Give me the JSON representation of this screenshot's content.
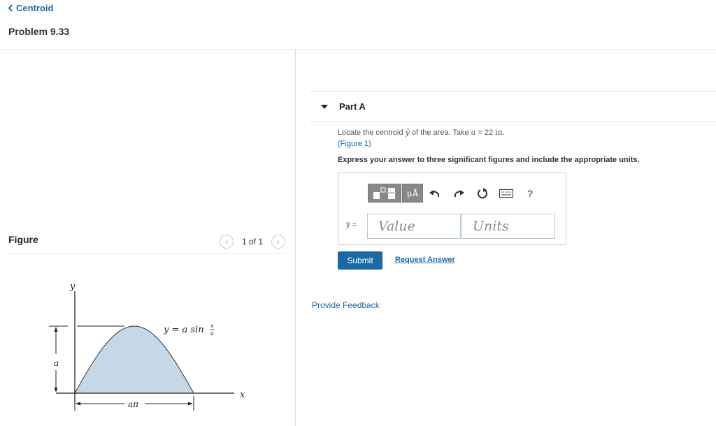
{
  "nav": {
    "back_label": "Centroid"
  },
  "problem": {
    "title": "Problem 9.33"
  },
  "figure_panel": {
    "label": "Figure",
    "pager_text": "1 of 1",
    "figure": {
      "y_axis": "y",
      "x_axis": "x",
      "height_dim": "a",
      "width_dim": "aπ",
      "equation": "y = a sin",
      "eq_num": "x",
      "eq_den": "a"
    }
  },
  "part_a": {
    "title": "Part A",
    "question_prefix": "Locate the centroid",
    "question_symbol": "ȳ",
    "question_middle": "of the area. Take",
    "question_var": "a",
    "question_value": " = 22",
    "question_unit": "in",
    "figure_link": "(Figure 1)",
    "instruction": "Express your answer to three significant figures and include the appropriate units.",
    "toolbar": {
      "units_label": "μÅ",
      "help_label": "?"
    },
    "answer_label": "ȳ =",
    "value_placeholder": "Value",
    "units_placeholder": "Units",
    "submit_label": "Submit",
    "request_label": "Request Answer"
  },
  "feedback_label": "Provide Feedback",
  "colors": {
    "accent": "#1a6aa8",
    "area_fill": "#c6d8e7",
    "toolbar_bg": "#888888"
  }
}
